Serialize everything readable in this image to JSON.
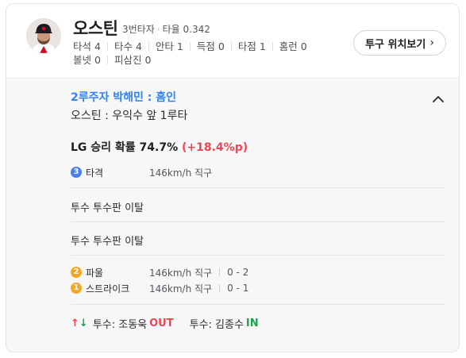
{
  "player": {
    "name": "오스틴",
    "order": "3번타자",
    "avg_label": "타율",
    "avg": "0.342",
    "stats": [
      {
        "label": "타석",
        "value": "4"
      },
      {
        "label": "타수",
        "value": "4"
      },
      {
        "label": "안타",
        "value": "1"
      },
      {
        "label": "득점",
        "value": "0"
      },
      {
        "label": "타점",
        "value": "1"
      },
      {
        "label": "홈런",
        "value": "0"
      },
      {
        "label": "볼넷",
        "value": "0"
      },
      {
        "label": "피삼진",
        "value": "0"
      }
    ],
    "pitch_button": "투구 위치보기"
  },
  "play": {
    "title": "2루주자 박해민 : 홈인",
    "description": "오스틴 : 우익수 앞 1루타",
    "win_prob": {
      "text": "LG 승리 확률 74.7%",
      "delta": "(+18.4%p)"
    },
    "events": [
      {
        "badge": "3",
        "name": "타격",
        "speed": "146km/h 직구",
        "count": "",
        "color": "#4a7ff3"
      },
      {
        "badge": "2",
        "name": "파울",
        "speed": "146km/h 직구",
        "count": "0 - 2",
        "color": "#f5a623"
      },
      {
        "badge": "1",
        "name": "스트라이크",
        "speed": "146km/h 직구",
        "count": "0 - 1",
        "color": "#f5a623"
      }
    ],
    "notes": [
      "투수 투수판 이탈",
      "투수 투수판 이탈"
    ],
    "pitcher_change": {
      "out_prefix": "투수: 조동욱",
      "out_label": "OUT",
      "in_prefix": "투수: 김종수",
      "in_label": "IN"
    }
  },
  "colors": {
    "accent_blue": "#3182f6",
    "delta_red": "#f04452",
    "in_green": "#1aa251"
  }
}
